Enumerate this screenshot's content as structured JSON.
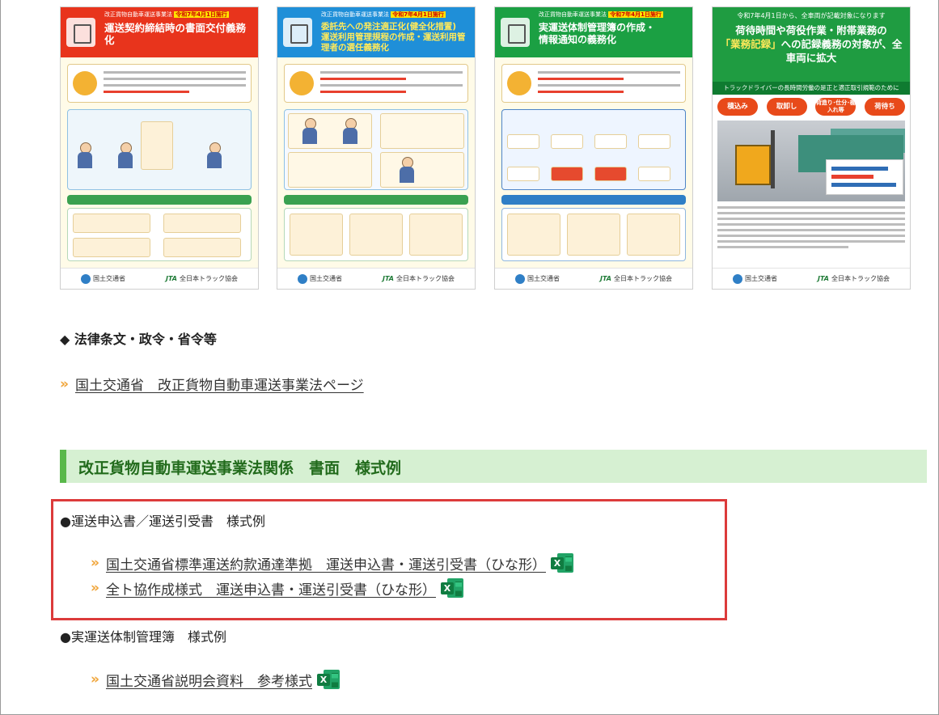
{
  "posters": [
    {
      "kicker_prefix": "改正貨物自動車運送事業法",
      "kicker_badge": "令和7年4月1日施行",
      "title_line1": "運送契約締結時の書面交付義務化",
      "title_line2": ""
    },
    {
      "kicker_prefix": "改正貨物自動車運送事業法",
      "kicker_badge": "令和7年4月1日施行",
      "title_line1": "委託先への発注適正化(健全化措置)",
      "title_line2": "運送利用管理規程の作成・運送利用管理者の選任義務化"
    },
    {
      "kicker_prefix": "改正貨物自動車運送事業法",
      "kicker_badge": "令和7年4月1日施行",
      "title_line1": "実運送体制管理簿の作成・",
      "title_line2": "情報通知の義務化"
    },
    {
      "subtitle": "令和7年4月1日から、全車両が記載対象になります",
      "title_line1": "荷待時間や荷役作業・附帯業務の",
      "title_highlight": "「業務記録」",
      "title_line2": "への記録義務の対象が、全車両に拡大",
      "strip": "トラックドライバーの長時間労働の是正と適正取引規範のために",
      "pills": [
        "積込み",
        "取卸し",
        "荷造り･仕分･棚入れ等",
        "荷待ち"
      ]
    }
  ],
  "poster_footer": {
    "mlit": "国土交通省",
    "jta_mark": "JTA",
    "jta": "全日本トラック協会"
  },
  "law_heading": "◆ 法律条文・政令・省令等",
  "law_link": "国土交通省　改正貨物自動車運送事業法ページ",
  "section_title": "改正貨物自動車運送事業法関係　書面　様式例",
  "groups": [
    {
      "heading": "●運送申込書／運送引受書　様式例",
      "links": [
        "国土交通省標準運送約款通達準拠　運送申込書・運送引受書（ひな形）",
        "全ト協作成様式　運送申込書・運送引受書（ひな形）"
      ]
    },
    {
      "heading": "●実運送体制管理簿　様式例",
      "links": [
        "国土交通省説明会資料　参考様式"
      ]
    }
  ],
  "icons": {
    "link_chevron": "»",
    "excel_letter": "X"
  },
  "colors": {
    "chevron": "#f0a53a",
    "highlight_box": "#dc3b3b",
    "section_bg": "#d6f0d2",
    "section_bar": "#59b84a",
    "excel": "#107c41"
  }
}
